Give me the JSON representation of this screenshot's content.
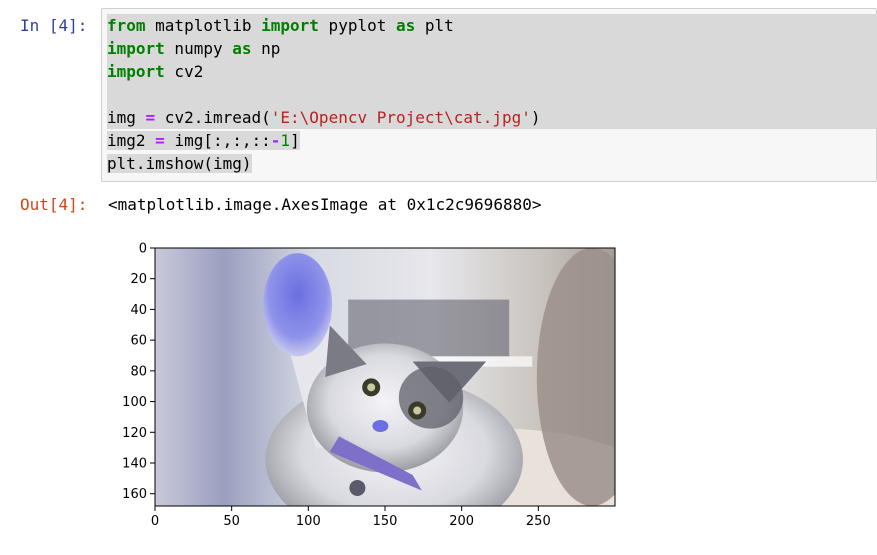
{
  "input_cell": {
    "prompt": "In [4]:",
    "lines": [
      [
        {
          "t": "from",
          "c": "kw"
        },
        {
          "t": " matplotlib ",
          "c": ""
        },
        {
          "t": "import",
          "c": "kw"
        },
        {
          "t": " pyplot ",
          "c": ""
        },
        {
          "t": "as",
          "c": "kw"
        },
        {
          "t": " plt",
          "c": ""
        }
      ],
      [
        {
          "t": "import",
          "c": "kw"
        },
        {
          "t": " numpy ",
          "c": ""
        },
        {
          "t": "as",
          "c": "kw"
        },
        {
          "t": " np",
          "c": ""
        }
      ],
      [
        {
          "t": "import",
          "c": "kw"
        },
        {
          "t": " cv2",
          "c": ""
        }
      ],
      [],
      [
        {
          "t": "img ",
          "c": ""
        },
        {
          "t": "=",
          "c": "op"
        },
        {
          "t": " cv2.imread(",
          "c": ""
        },
        {
          "t": "'E:\\Opencv Project\\cat.jpg'",
          "c": "str"
        },
        {
          "t": ")",
          "c": ""
        }
      ],
      [
        {
          "t": "img2 ",
          "c": ""
        },
        {
          "t": "=",
          "c": "op"
        },
        {
          "t": " img[:,:,::",
          "c": ""
        },
        {
          "t": "-",
          "c": "op"
        },
        {
          "t": "1",
          "c": "num"
        },
        {
          "t": "]",
          "c": ""
        }
      ],
      [
        {
          "t": "plt.imshow(img)",
          "c": ""
        }
      ]
    ]
  },
  "output_cell": {
    "prompt": "Out[4]:",
    "text": "<matplotlib.image.AxesImage at 0x1c2c9696880>"
  },
  "chart_data": {
    "type": "image",
    "title": "",
    "xlabel": "",
    "ylabel": "",
    "xlim": [
      0,
      300
    ],
    "ylim": [
      168,
      0
    ],
    "x_ticks": [
      0,
      50,
      100,
      150,
      200,
      250
    ],
    "y_ticks": [
      0,
      20,
      40,
      60,
      80,
      100,
      120,
      140,
      160
    ],
    "image_content": "cat-photo"
  },
  "colors": {
    "in_prompt": "#303f9f",
    "out_prompt": "#d84315",
    "keyword": "#008000",
    "operator": "#aa22ff",
    "string": "#ba2121"
  }
}
